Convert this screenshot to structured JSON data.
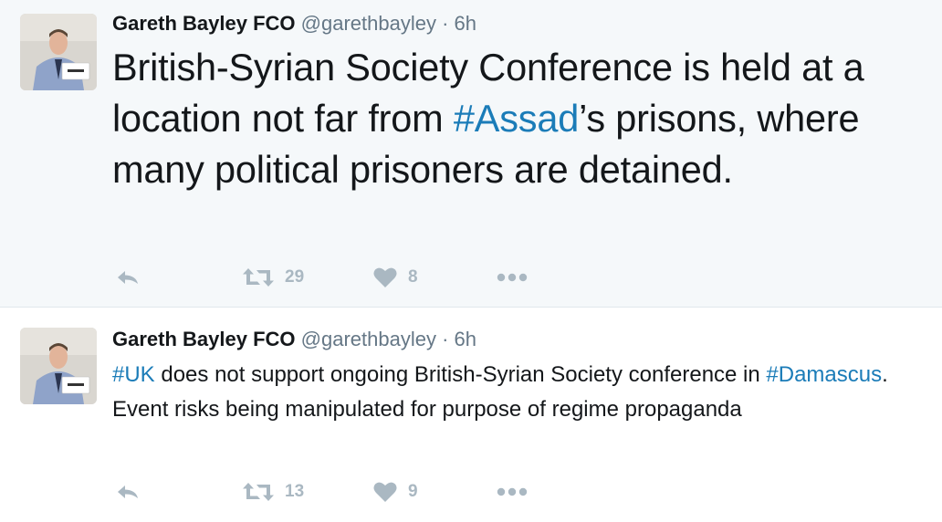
{
  "tweets": [
    {
      "author": "Gareth Bayley FCO",
      "handle": "@garethbayley",
      "separator": "·",
      "time": "6h",
      "text_parts": [
        {
          "text": "British-Syrian Society Conference is held at a location not far from ",
          "hashtag": false
        },
        {
          "text": "#Assad",
          "hashtag": true
        },
        {
          "text": "’s prisons, where many political prisoners are detained.",
          "hashtag": false
        }
      ],
      "retweets": "29",
      "likes": "8"
    },
    {
      "author": "Gareth Bayley FCO",
      "handle": "@garethbayley",
      "separator": "·",
      "time": "6h",
      "text_parts": [
        {
          "text": "#UK",
          "hashtag": true
        },
        {
          "text": " does not support ongoing British-Syrian Society conference in ",
          "hashtag": false
        },
        {
          "text": "#Damascus",
          "hashtag": true
        },
        {
          "text": ". Event risks being manipulated for purpose of regime propaganda",
          "hashtag": false
        }
      ],
      "retweets": "13",
      "likes": "9"
    }
  ],
  "colors": {
    "hashtag": "#1b7cb8",
    "secondary_text": "#657786",
    "action_icon": "#aab8c2",
    "highlight_background": "#f5f8fa"
  },
  "icons": [
    "reply-icon",
    "retweet-icon",
    "heart-icon",
    "more-icon"
  ]
}
